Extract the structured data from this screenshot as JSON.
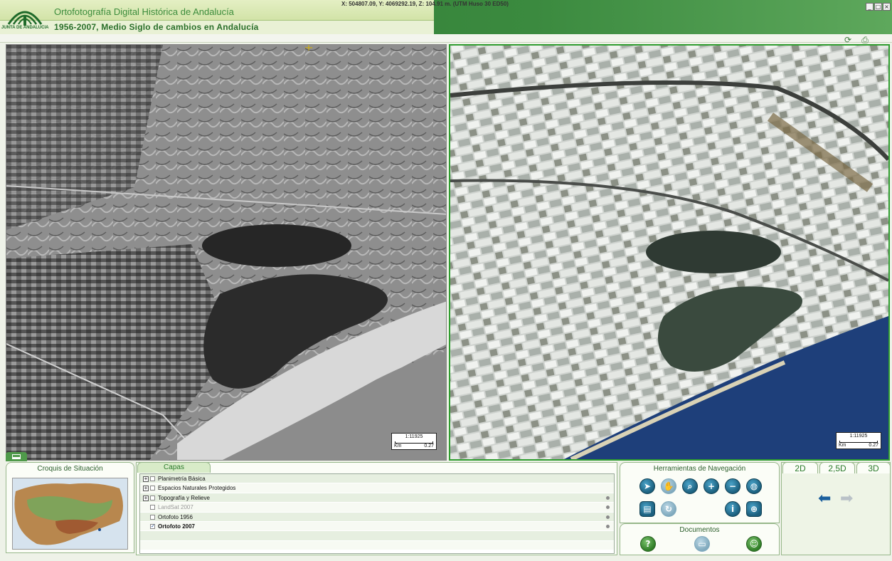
{
  "header": {
    "logo_text": "JUNTA DE ANDALUCIA",
    "title": "Ortofotografía Digital Histórica de Andalucía",
    "subtitle": "1956-2007, Medio Siglo de cambios en Andalucía",
    "window_buttons": [
      "_",
      "□",
      "×"
    ]
  },
  "coords": "X: 504807.09, Y: 4069292.19, Z: 104.91 m. (UTM Huso 30 ED50)",
  "toolbar_icons": [
    "refresh-icon",
    "print-icon"
  ],
  "maps": {
    "left": {
      "scale": "1:11925",
      "km_label": "Km",
      "km_value": "0.27"
    },
    "right": {
      "scale": "1:11925",
      "km_label": "Km",
      "km_value": "0.27"
    }
  },
  "croquis": {
    "title": "Croquis de Situación"
  },
  "capas": {
    "tab_label": "Capas",
    "layers": [
      {
        "label": "Planimetría Básica",
        "expandable": true,
        "checked": false,
        "disabled": false,
        "bold": false,
        "info": false
      },
      {
        "label": "Espacios Naturales Protegidos",
        "expandable": true,
        "checked": false,
        "disabled": false,
        "bold": false,
        "info": false
      },
      {
        "label": "Topografía y Relieve",
        "expandable": true,
        "checked": false,
        "disabled": false,
        "bold": false,
        "info": true
      },
      {
        "label": "LandSat 2007",
        "expandable": false,
        "checked": false,
        "disabled": true,
        "bold": false,
        "info": true
      },
      {
        "label": "Ortofoto 1956",
        "expandable": false,
        "checked": false,
        "disabled": false,
        "bold": false,
        "info": true
      },
      {
        "label": "Ortofoto 2007",
        "expandable": false,
        "checked": true,
        "disabled": false,
        "bold": true,
        "info": true
      }
    ]
  },
  "navigation": {
    "title": "Herramientas de Navegación",
    "tools": [
      "select-arrow-icon",
      "pan-hand-icon",
      "zoom-box-icon",
      "zoom-in-icon",
      "zoom-out-icon",
      "full-extent-globe-icon",
      "layers-panel-icon",
      "refresh-view-icon",
      "info-icon",
      "measure-icon"
    ]
  },
  "documents": {
    "title": "Documentos",
    "tools": [
      "help-icon",
      "document-icon",
      "people-icon"
    ]
  },
  "view_tabs": [
    "2D",
    "2,5D",
    "3D"
  ],
  "colors": {
    "brand_green": "#2e7a33",
    "accent_blue": "#1b5f7d"
  }
}
